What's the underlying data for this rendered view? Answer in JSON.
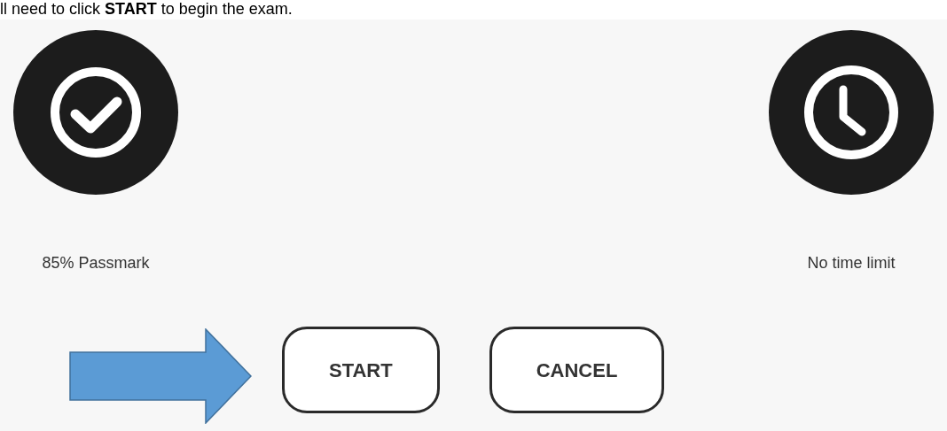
{
  "instruction": "ll need to click **START** to begin the exam.",
  "features": [
    {
      "kind": "check",
      "label": "85% Passmark"
    },
    {
      "kind": "clock",
      "label": "No time limit"
    }
  ],
  "buttons": [
    "START",
    "CANCEL"
  ]
}
